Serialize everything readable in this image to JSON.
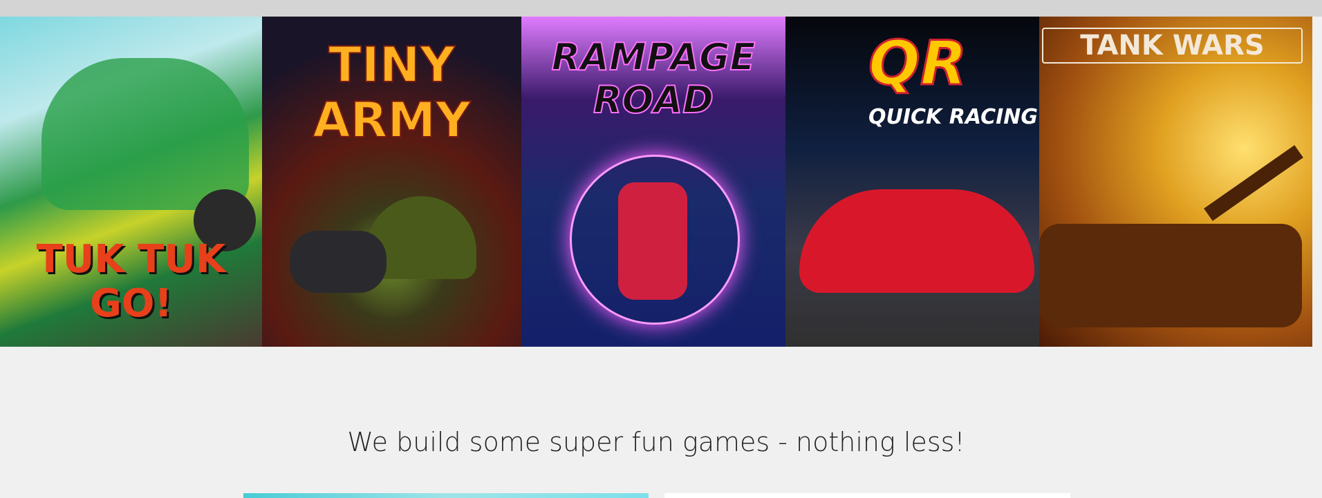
{
  "games": [
    {
      "title": "TUK TUK GO!",
      "subtitle": ""
    },
    {
      "title": "TINY ARMY",
      "subtitle": ""
    },
    {
      "title": "RAMPAGE ROAD",
      "subtitle": ""
    },
    {
      "title": "QR",
      "subtitle": "QUICK RACING"
    },
    {
      "title": "TANK WARS",
      "subtitle": ""
    }
  ],
  "tagline": "We build some super fun games - nothing less!"
}
